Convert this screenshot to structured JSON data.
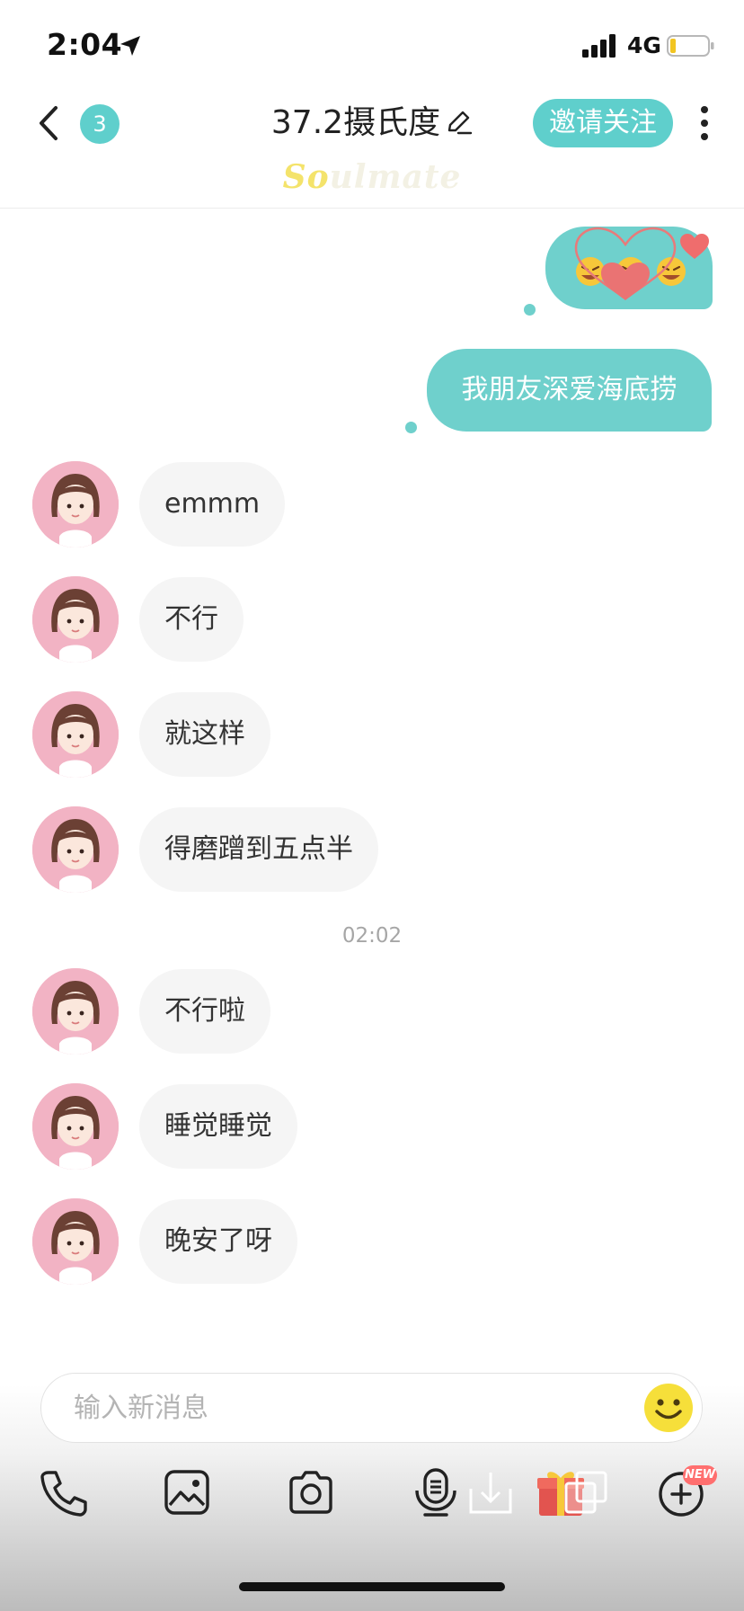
{
  "status_bar": {
    "time": "2:04",
    "network": "4G"
  },
  "header": {
    "unread_count": "3",
    "title": "37.2摄氏度",
    "follow_button": "邀请关注",
    "brand_part1": "So",
    "brand_part2": "ulmate"
  },
  "messages": {
    "outgoing_text": "我朋友深爱海底捞",
    "incoming": [
      "emmm",
      "不行",
      "就这样",
      "得磨蹭到五点半",
      "不行啦",
      "睡觉睡觉",
      "晚安了呀"
    ],
    "timestamp": "02:02"
  },
  "input": {
    "placeholder": "输入新消息"
  },
  "toolbar": {
    "new_badge": "NEW",
    "icons": [
      "phone-icon",
      "image-icon",
      "camera-icon",
      "voice-icon",
      "download-icon",
      "gift-icon",
      "copy-icon",
      "plus-icon"
    ]
  },
  "colors": {
    "accent": "#5fcfcc",
    "bubble_out": "#6fd0cc",
    "bubble_in": "#f5f5f5",
    "avatar_bg": "#f2b3c4"
  }
}
